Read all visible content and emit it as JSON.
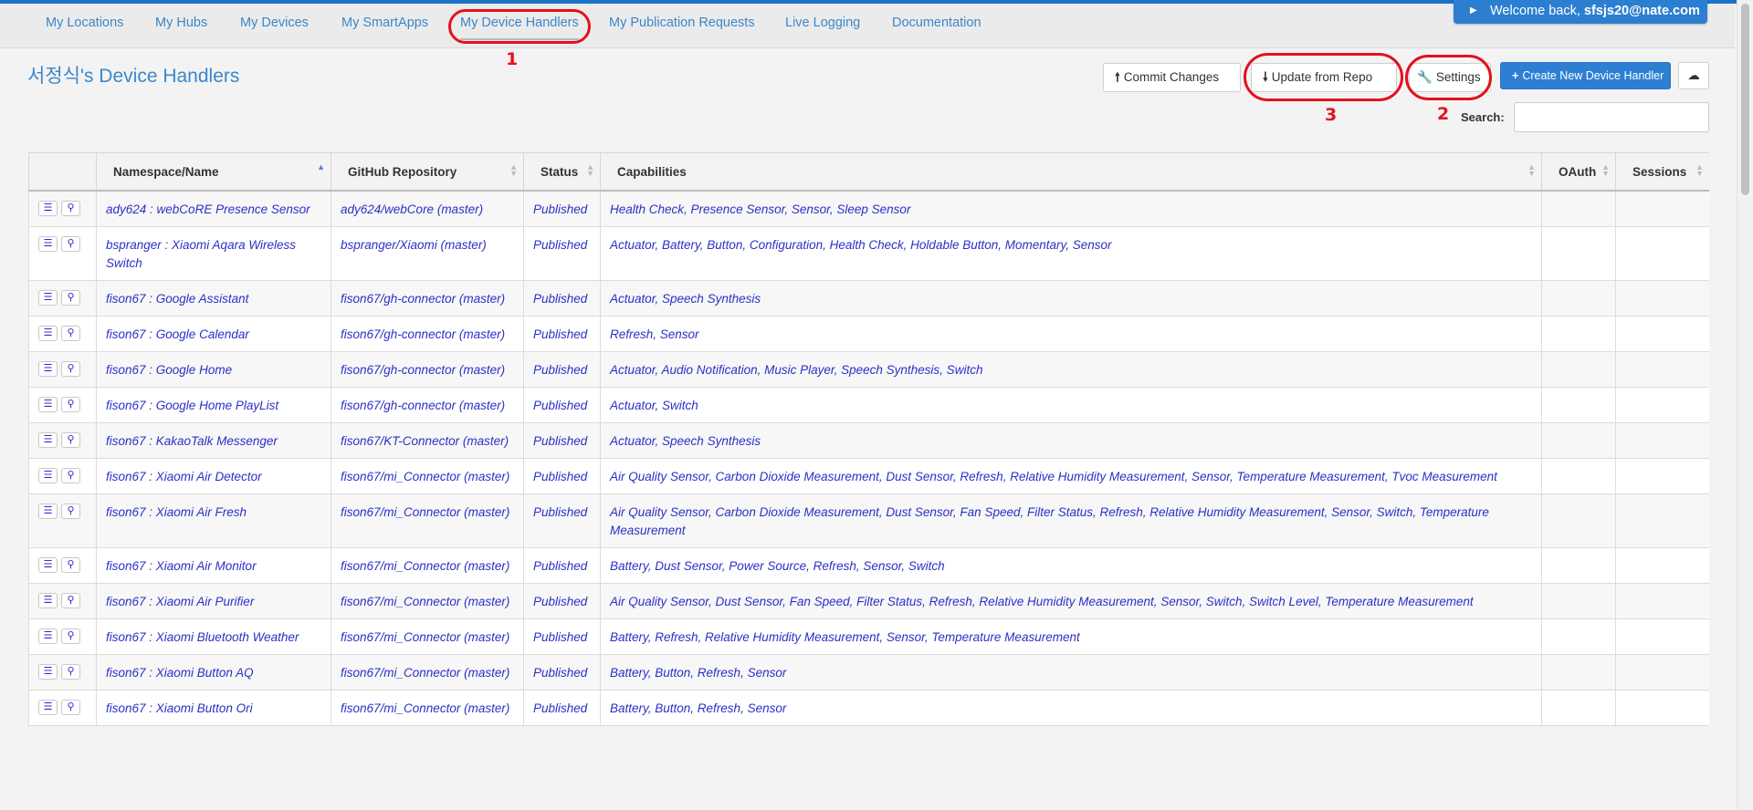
{
  "nav": {
    "items": [
      {
        "label": "My Locations"
      },
      {
        "label": "My Hubs"
      },
      {
        "label": "My Devices"
      },
      {
        "label": "My SmartApps"
      },
      {
        "label": "My Device Handlers"
      },
      {
        "label": "My Publication Requests"
      },
      {
        "label": "Live Logging"
      },
      {
        "label": "Documentation"
      }
    ],
    "welcome_prefix": "Welcome back, ",
    "welcome_user": "sfsjs20@nate.com"
  },
  "page": {
    "title": "서정식's Device Handlers"
  },
  "toolbar": {
    "commit_label": "Commit Changes",
    "update_label": "Update from Repo",
    "settings_label": "Settings",
    "create_label": "Create New Device Handler",
    "search_label": "Search:",
    "search_value": ""
  },
  "annotations": {
    "one": "1",
    "two": "2",
    "three": "3"
  },
  "table": {
    "headers": {
      "name": "Namespace/Name",
      "repo": "GitHub Repository",
      "status": "Status",
      "capabilities": "Capabilities",
      "oauth": "OAuth",
      "sessions": "Sessions"
    },
    "rows": [
      {
        "name": "ady624 : webCoRE Presence Sensor",
        "repo": "ady624/webCore (master)",
        "status": "Published",
        "capabilities": "Health Check, Presence Sensor, Sensor, Sleep Sensor"
      },
      {
        "name": "bspranger : Xiaomi Aqara Wireless Switch",
        "repo": "bspranger/Xiaomi (master)",
        "status": "Published",
        "capabilities": "Actuator, Battery, Button, Configuration, Health Check, Holdable Button, Momentary, Sensor"
      },
      {
        "name": "fison67 : Google Assistant",
        "repo": "fison67/gh-connector (master)",
        "status": "Published",
        "capabilities": "Actuator, Speech Synthesis"
      },
      {
        "name": "fison67 : Google Calendar",
        "repo": "fison67/gh-connector (master)",
        "status": "Published",
        "capabilities": "Refresh, Sensor"
      },
      {
        "name": "fison67 : Google Home",
        "repo": "fison67/gh-connector (master)",
        "status": "Published",
        "capabilities": "Actuator, Audio Notification, Music Player, Speech Synthesis, Switch"
      },
      {
        "name": "fison67 : Google Home PlayList",
        "repo": "fison67/gh-connector (master)",
        "status": "Published",
        "capabilities": "Actuator, Switch"
      },
      {
        "name": "fison67 : KakaoTalk Messenger",
        "repo": "fison67/KT-Connector (master)",
        "status": "Published",
        "capabilities": "Actuator, Speech Synthesis"
      },
      {
        "name": "fison67 : Xiaomi Air Detector",
        "repo": "fison67/mi_Connector (master)",
        "status": "Published",
        "capabilities": "Air Quality Sensor, Carbon Dioxide Measurement, Dust Sensor, Refresh, Relative Humidity Measurement, Sensor, Temperature Measurement, Tvoc Measurement"
      },
      {
        "name": "fison67 : Xiaomi Air Fresh",
        "repo": "fison67/mi_Connector (master)",
        "status": "Published",
        "capabilities": "Air Quality Sensor, Carbon Dioxide Measurement, Dust Sensor, Fan Speed, Filter Status, Refresh, Relative Humidity Measurement, Sensor, Switch, Temperature Measurement"
      },
      {
        "name": "fison67 : Xiaomi Air Monitor",
        "repo": "fison67/mi_Connector (master)",
        "status": "Published",
        "capabilities": "Battery, Dust Sensor, Power Source, Refresh, Sensor, Switch"
      },
      {
        "name": "fison67 : Xiaomi Air Purifier",
        "repo": "fison67/mi_Connector (master)",
        "status": "Published",
        "capabilities": "Air Quality Sensor, Dust Sensor, Fan Speed, Filter Status, Refresh, Relative Humidity Measurement, Sensor, Switch, Switch Level, Temperature Measurement"
      },
      {
        "name": "fison67 : Xiaomi Bluetooth Weather",
        "repo": "fison67/mi_Connector (master)",
        "status": "Published",
        "capabilities": "Battery, Refresh, Relative Humidity Measurement, Sensor, Temperature Measurement"
      },
      {
        "name": "fison67 : Xiaomi Button AQ",
        "repo": "fison67/mi_Connector (master)",
        "status": "Published",
        "capabilities": "Battery, Button, Refresh, Sensor"
      },
      {
        "name": "fison67 : Xiaomi Button Ori",
        "repo": "fison67/mi_Connector (master)",
        "status": "Published",
        "capabilities": "Battery, Button, Refresh, Sensor"
      }
    ]
  }
}
